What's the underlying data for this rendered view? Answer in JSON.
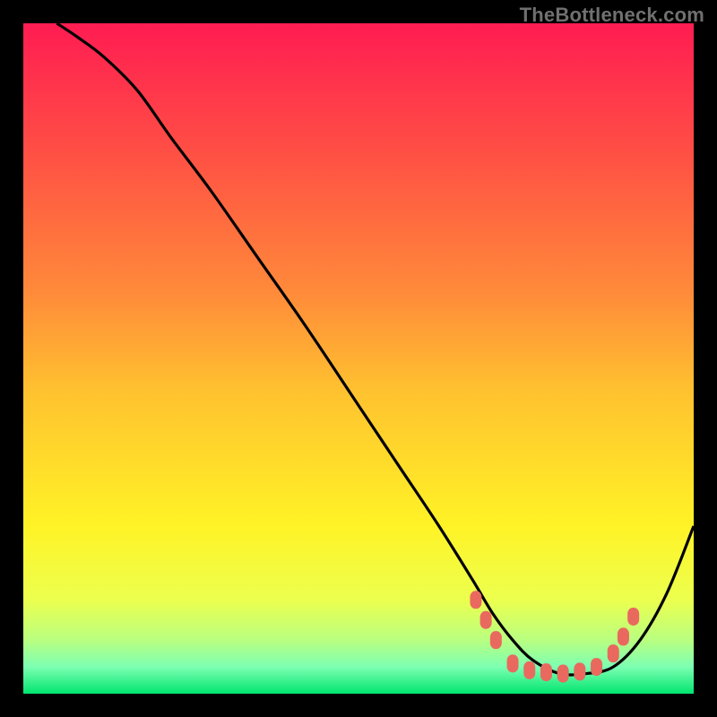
{
  "watermark": "TheBottleneck.com",
  "chart_data": {
    "type": "line",
    "title": "",
    "xlabel": "",
    "ylabel": "",
    "xlim": [
      0,
      100
    ],
    "ylim": [
      0,
      100
    ],
    "grid": false,
    "legend": false,
    "background_gradient": {
      "stops": [
        {
          "offset": 0,
          "color": "#ff1c52"
        },
        {
          "offset": 20,
          "color": "#ff5144"
        },
        {
          "offset": 40,
          "color": "#ff8a3a"
        },
        {
          "offset": 55,
          "color": "#ffc22f"
        },
        {
          "offset": 75,
          "color": "#fff326"
        },
        {
          "offset": 86,
          "color": "#ecff4e"
        },
        {
          "offset": 92,
          "color": "#b9ff80"
        },
        {
          "offset": 96,
          "color": "#7dffb2"
        },
        {
          "offset": 100,
          "color": "#00e56f"
        }
      ]
    },
    "series": [
      {
        "name": "bottleneck-curve",
        "color": "#000000",
        "x": [
          5,
          8,
          12,
          17,
          22,
          28,
          35,
          42,
          50,
          56,
          62,
          67,
          70,
          73,
          76,
          80,
          84,
          88,
          92,
          96,
          100
        ],
        "y": [
          100,
          98,
          95,
          90,
          83,
          75,
          65,
          55,
          43,
          34,
          25,
          17,
          12,
          8,
          5,
          3,
          3,
          4,
          8,
          15,
          25
        ]
      }
    ],
    "markers": {
      "name": "highlight-dots",
      "color": "#e9695f",
      "points": [
        {
          "x": 67.5,
          "y": 14
        },
        {
          "x": 69.0,
          "y": 11
        },
        {
          "x": 70.5,
          "y": 8
        },
        {
          "x": 73.0,
          "y": 4.5
        },
        {
          "x": 75.5,
          "y": 3.5
        },
        {
          "x": 78.0,
          "y": 3.2
        },
        {
          "x": 80.5,
          "y": 3.0
        },
        {
          "x": 83.0,
          "y": 3.3
        },
        {
          "x": 85.5,
          "y": 4.0
        },
        {
          "x": 88.0,
          "y": 6.0
        },
        {
          "x": 89.5,
          "y": 8.5
        },
        {
          "x": 91.0,
          "y": 11.5
        }
      ]
    }
  }
}
